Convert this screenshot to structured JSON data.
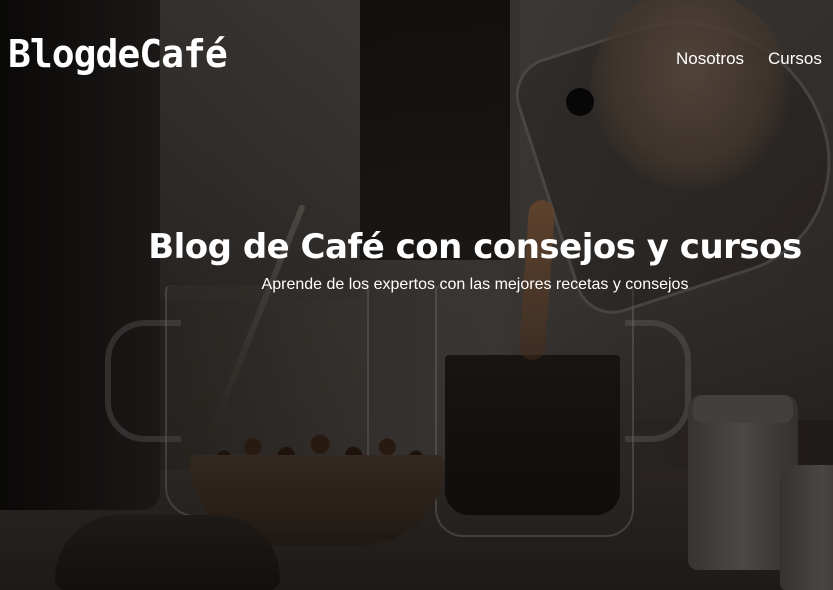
{
  "header": {
    "logo": "BlogdeCafé",
    "nav": [
      {
        "label": "Nosotros"
      },
      {
        "label": "Cursos"
      }
    ]
  },
  "hero": {
    "title": "Blog de Café con consejos y cursos",
    "subtitle": "Aprende de los expertos con las mejores recetas y consejos"
  },
  "colors": {
    "text": "#ffffff",
    "overlay": "rgba(0,0,0,0.28)"
  }
}
